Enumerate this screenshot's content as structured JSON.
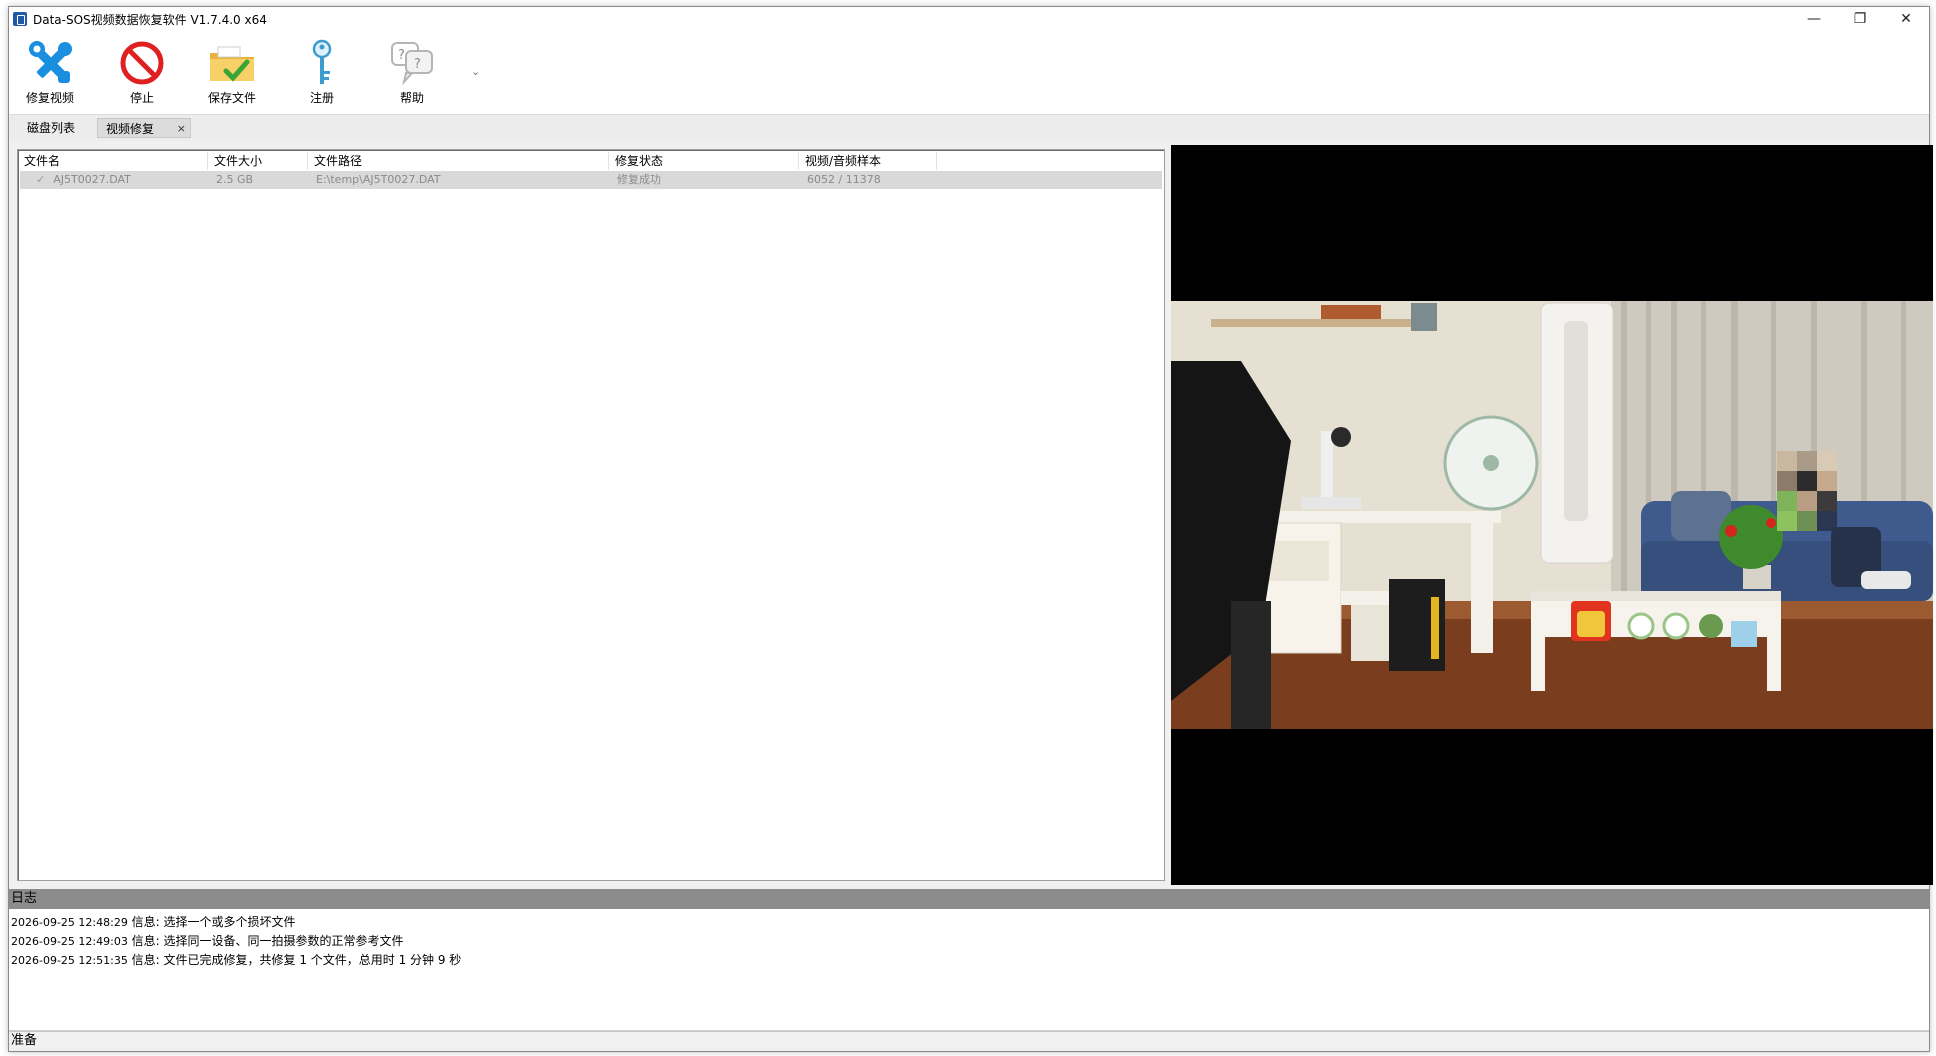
{
  "window": {
    "title": "Data-SOS视频数据恢复软件 V1.7.4.0 x64",
    "controls": {
      "minimize": "—",
      "restore": "❐",
      "close": "✕"
    }
  },
  "toolbar": {
    "items": [
      {
        "label": "修复视频",
        "icon": "wrench-screwdriver-icon"
      },
      {
        "label": "停止",
        "icon": "stop-icon"
      },
      {
        "label": "保存文件",
        "icon": "folder-check-icon"
      },
      {
        "label": "注册",
        "icon": "key-icon"
      },
      {
        "label": "帮助",
        "icon": "help-bubble-icon"
      }
    ],
    "more": "⌄"
  },
  "tabs": [
    {
      "label": "磁盘列表"
    },
    {
      "label": "视频修复",
      "close": "×"
    }
  ],
  "file_list": {
    "columns": [
      "文件名",
      "文件大小",
      "文件路径",
      "修复状态",
      "视频/音频样本"
    ],
    "rows": [
      {
        "check": "✓",
        "name": "AJ5T0027.DAT",
        "size": "2.5 GB",
        "path": "E:\\temp\\AJ5T0027.DAT",
        "status": "修复成功",
        "samples": "6052 / 11378"
      }
    ]
  },
  "log": {
    "title": "日志",
    "entries": [
      {
        "time": "2026-09-25 12:48:29",
        "message": "信息: 选择一个或多个损坏文件"
      },
      {
        "time": "2026-09-25 12:49:03",
        "message": "信息: 选择同一设备、同一拍摄参数的正常参考文件"
      },
      {
        "time": "2026-09-25 12:51:35",
        "message": "信息: 文件已完成修复，共修复 1 个文件，总用时 1 分钟 9 秒"
      }
    ]
  },
  "status": {
    "text": "准备"
  },
  "colors": {
    "accent_blue": "#1a8fe0",
    "stop_red": "#e02020",
    "folder_yellow": "#f2c24b",
    "check_green": "#3aa535"
  }
}
